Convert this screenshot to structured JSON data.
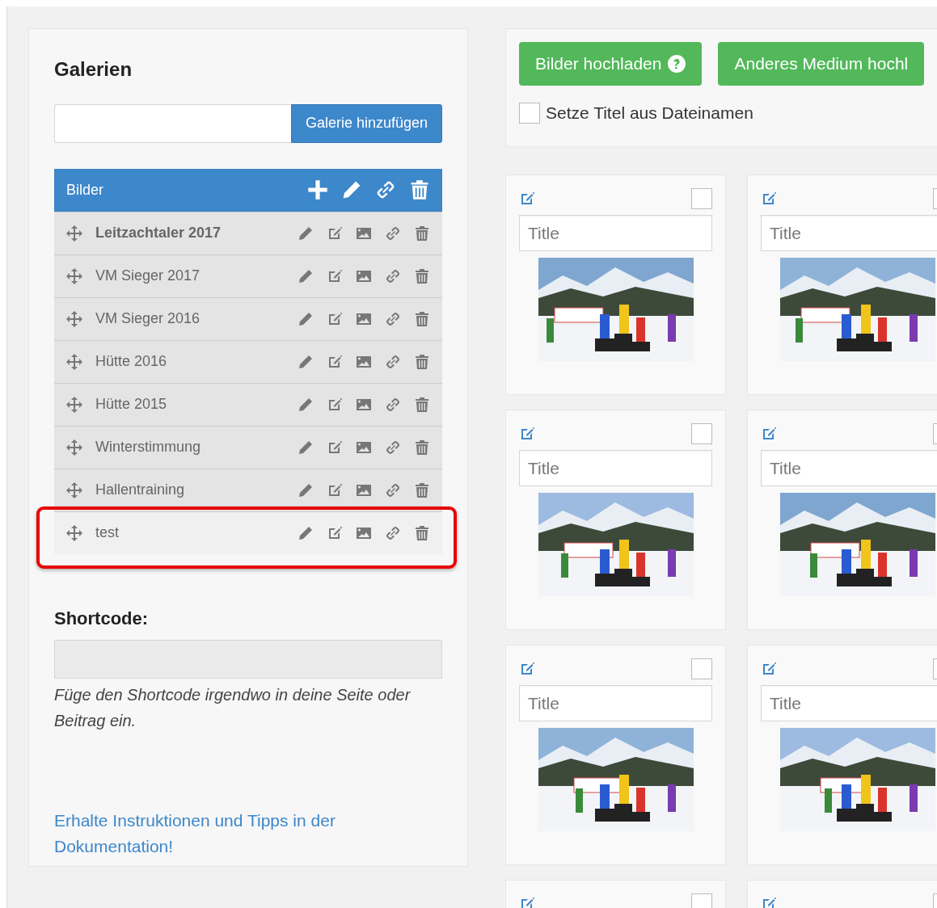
{
  "sidebar": {
    "title": "Galerien",
    "add_button": "Galerie hinzufügen",
    "list": {
      "header": "Bilder",
      "items": [
        {
          "name": "Leitzachtaler 2017",
          "selected": true,
          "hovered": false,
          "outlined": false
        },
        {
          "name": "VM Sieger 2017",
          "selected": false,
          "hovered": false,
          "outlined": false
        },
        {
          "name": "VM Sieger 2016",
          "selected": false,
          "hovered": false,
          "outlined": false
        },
        {
          "name": "Hütte 2016",
          "selected": false,
          "hovered": false,
          "outlined": false
        },
        {
          "name": "Hütte 2015",
          "selected": false,
          "hovered": false,
          "outlined": false
        },
        {
          "name": "Winterstimmung",
          "selected": false,
          "hovered": false,
          "outlined": false
        },
        {
          "name": "Hallentraining",
          "selected": false,
          "hovered": false,
          "outlined": false
        },
        {
          "name": "test",
          "selected": false,
          "hovered": true,
          "outlined": true
        }
      ]
    },
    "shortcode_label": "Shortcode:",
    "shortcode_help": "Füge den Shortcode irgendwo in deine Seite oder Beitrag ein.",
    "docs_link": "Erhalte Instruktionen und Tipps in der Dokumentation!"
  },
  "upload": {
    "buttons": [
      {
        "label": "Bilder hochladen",
        "help": true
      },
      {
        "label": "Anderes Medium hochl",
        "help": false
      }
    ],
    "filename_title": {
      "label": "Setze Titel aus Dateinamen",
      "checked": false
    }
  },
  "images": [
    {
      "placeholder": "Title",
      "checked": false,
      "kind": "picture"
    },
    {
      "placeholder": "Title",
      "checked": false,
      "kind": "picture"
    },
    {
      "placeholder": "Title",
      "checked": false,
      "kind": "picture"
    },
    {
      "placeholder": "Title",
      "checked": false,
      "kind": "picture"
    },
    {
      "placeholder": "Title",
      "checked": false,
      "kind": "picture"
    },
    {
      "placeholder": "Title",
      "checked": false,
      "kind": "picture"
    },
    {
      "checked": false
    },
    {
      "checked": false
    }
  ]
}
